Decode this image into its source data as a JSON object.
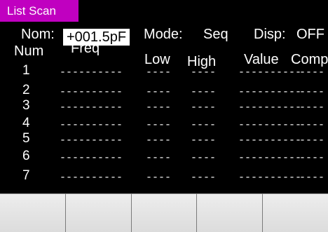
{
  "title": "List Scan",
  "colors": {
    "accent": "#c000c0"
  },
  "header": {
    "nom_label": "Nom:",
    "nom_value": "+001.5pF",
    "mode_label": "Mode:",
    "mode_value": "Seq",
    "disp_label": "Disp:",
    "disp_value": "OFF"
  },
  "columns": {
    "num": "Num",
    "freq": "Freq",
    "low": "Low",
    "high": "High",
    "value": "Value",
    "comp": "Comp"
  },
  "rows": [
    {
      "num": "1",
      "freq": "----------",
      "low": "----",
      "high": "----",
      "value": "----------",
      "comp": "----"
    },
    {
      "num": "2",
      "freq": "----------",
      "low": "----",
      "high": "----",
      "value": "----------",
      "comp": "----"
    },
    {
      "num": "3",
      "freq": "----------",
      "low": "----",
      "high": "----",
      "value": "----------",
      "comp": "----"
    },
    {
      "num": "4",
      "freq": "----------",
      "low": "----",
      "high": "----",
      "value": "----------",
      "comp": "----"
    },
    {
      "num": "5",
      "freq": "----------",
      "low": "----",
      "high": "----",
      "value": "----------",
      "comp": "----"
    },
    {
      "num": "6",
      "freq": "----------",
      "low": "----",
      "high": "----",
      "value": "----------",
      "comp": "----"
    },
    {
      "num": "7",
      "freq": "----------",
      "low": "----",
      "high": "----",
      "value": "----------",
      "comp": "----"
    }
  ],
  "softkeys": [
    "",
    "",
    "",
    "",
    ""
  ]
}
